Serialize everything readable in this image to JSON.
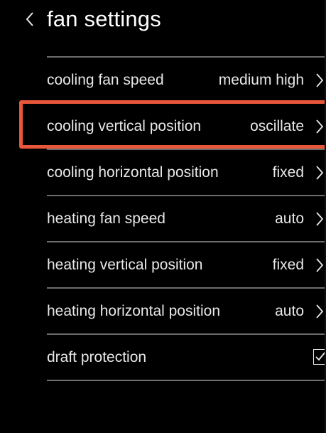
{
  "header": {
    "title": "fan settings",
    "back_icon": "chevron-left-icon"
  },
  "settings": [
    {
      "label": "cooling fan speed",
      "value": "medium high",
      "icon": "chevron-right-icon"
    },
    {
      "label": "cooling vertical position",
      "value": "oscillate",
      "icon": "chevron-right-icon"
    },
    {
      "label": "cooling horizontal position",
      "value": "fixed",
      "icon": "chevron-right-icon"
    },
    {
      "label": "heating fan speed",
      "value": "auto",
      "icon": "chevron-right-icon"
    },
    {
      "label": "heating vertical position",
      "value": "fixed",
      "icon": "chevron-right-icon"
    },
    {
      "label": "heating horizontal position",
      "value": "auto",
      "icon": "chevron-right-icon"
    }
  ],
  "draft_protection": {
    "label": "draft protection",
    "checked": true,
    "icon": "checkbox-checked-icon"
  },
  "highlight": {
    "target": "cooling vertical position",
    "color": "#e9573a"
  },
  "colors": {
    "background": "#000000",
    "text": "#e8e8e8",
    "divider": "#6d6d6d"
  }
}
